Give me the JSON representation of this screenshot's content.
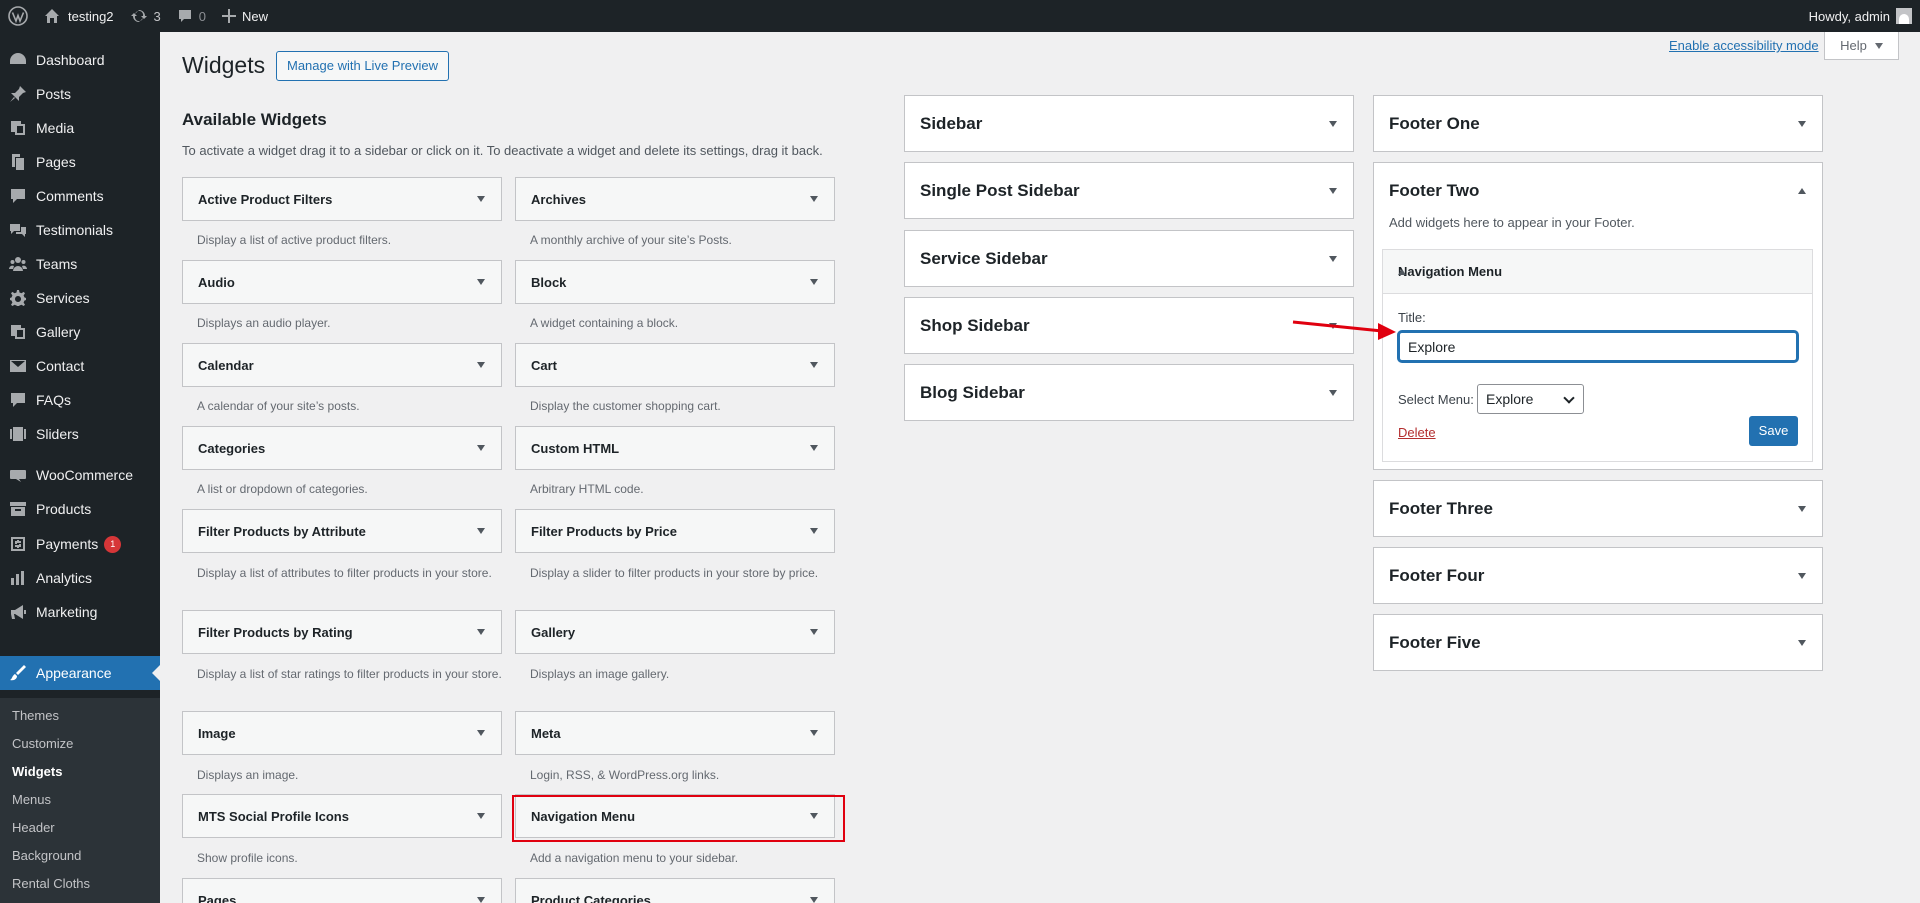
{
  "adminbar": {
    "site_name": "testing2",
    "updates_count": "3",
    "comments_count": "0",
    "new_label": "New",
    "howdy": "Howdy, admin"
  },
  "menu": {
    "items": [
      {
        "label": "Dashboard",
        "icon": "dashboard-icon"
      },
      {
        "label": "Posts",
        "icon": "pin-icon"
      },
      {
        "label": "Media",
        "icon": "media-icon"
      },
      {
        "label": "Pages",
        "icon": "pages-icon"
      },
      {
        "label": "Comments",
        "icon": "comment-icon"
      },
      {
        "label": "Testimonials",
        "icon": "testimonial-icon"
      },
      {
        "label": "Teams",
        "icon": "groups-icon"
      },
      {
        "label": "Services",
        "icon": "gear-icon"
      },
      {
        "label": "Gallery",
        "icon": "gallery-icon"
      },
      {
        "label": "Contact",
        "icon": "envelope-icon"
      },
      {
        "label": "FAQs",
        "icon": "faq-icon"
      },
      {
        "label": "Sliders",
        "icon": "slides-icon"
      },
      {
        "label": "WooCommerce",
        "icon": "woo-icon"
      },
      {
        "label": "Products",
        "icon": "archive-icon"
      },
      {
        "label": "Payments",
        "icon": "dollar-icon",
        "badge": "1"
      },
      {
        "label": "Analytics",
        "icon": "chart-bar-icon"
      },
      {
        "label": "Marketing",
        "icon": "megaphone-icon"
      },
      {
        "label": "Appearance",
        "icon": "brush-icon"
      }
    ],
    "submenu": [
      "Themes",
      "Customize",
      "Widgets",
      "Menus",
      "Header",
      "Background",
      "Rental Cloths"
    ]
  },
  "page": {
    "title": "Widgets",
    "live_preview_label": "Manage with Live Preview",
    "accessibility_link": "Enable accessibility mode",
    "help_label": "Help"
  },
  "available": {
    "title": "Available Widgets",
    "description": "To activate a widget drag it to a sidebar or click on it. To deactivate a widget and delete its settings, drag it back.",
    "widgets": [
      {
        "name": "Active Product Filters",
        "desc": "Display a list of active product filters."
      },
      {
        "name": "Archives",
        "desc": "A monthly archive of your site’s Posts."
      },
      {
        "name": "Audio",
        "desc": "Displays an audio player."
      },
      {
        "name": "Block",
        "desc": "A widget containing a block."
      },
      {
        "name": "Calendar",
        "desc": "A calendar of your site’s posts."
      },
      {
        "name": "Cart",
        "desc": "Display the customer shopping cart."
      },
      {
        "name": "Categories",
        "desc": "A list or dropdown of categories."
      },
      {
        "name": "Custom HTML",
        "desc": "Arbitrary HTML code."
      },
      {
        "name": "Filter Products by Attribute",
        "desc": "Display a list of attributes to filter products in your store."
      },
      {
        "name": "Filter Products by Price",
        "desc": "Display a slider to filter products in your store by price."
      },
      {
        "name": "Filter Products by Rating",
        "desc": "Display a list of star ratings to filter products in your store."
      },
      {
        "name": "Gallery",
        "desc": "Displays an image gallery."
      },
      {
        "name": "Image",
        "desc": "Displays an image."
      },
      {
        "name": "Meta",
        "desc": "Login, RSS, & WordPress.org links."
      },
      {
        "name": "MTS Social Profile Icons",
        "desc": "Show profile icons."
      },
      {
        "name": "Navigation Menu",
        "desc": "Add a navigation menu to your sidebar."
      },
      {
        "name": "Pages",
        "desc": ""
      },
      {
        "name": "Product Categories",
        "desc": ""
      }
    ]
  },
  "sidebars": {
    "left": [
      "Sidebar",
      "Single Post Sidebar",
      "Service Sidebar",
      "Shop Sidebar",
      "Blog Sidebar"
    ],
    "right": [
      "Footer One",
      "Footer Two",
      "Footer Three",
      "Footer Four",
      "Footer Five"
    ]
  },
  "footer_two": {
    "description": "Add widgets here to appear in your Footer.",
    "widget_title": "Navigation Menu",
    "title_label": "Title:",
    "title_value": "Explore",
    "select_label": "Select Menu:",
    "select_value": "Explore",
    "delete_label": "Delete",
    "save_label": "Save"
  },
  "colors": {
    "accent": "#2271b1",
    "adminbar": "#1d2327",
    "highlight": "#e0000f",
    "badge": "#d63638"
  }
}
